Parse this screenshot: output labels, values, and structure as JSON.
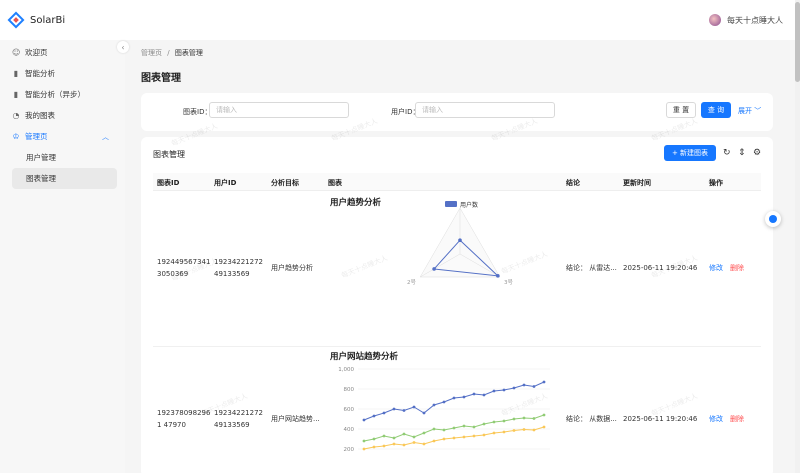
{
  "app": {
    "name": "SolarBi"
  },
  "user": {
    "name": "每天十点睡大人"
  },
  "sidebar": {
    "items": [
      {
        "label": "欢迎页",
        "icon": "smile-icon"
      },
      {
        "label": "智能分析",
        "icon": "bar-chart-icon"
      },
      {
        "label": "智能分析（异步）",
        "icon": "bar-chart-icon"
      },
      {
        "label": "我的图表",
        "icon": "pie-chart-icon"
      },
      {
        "label": "管理页",
        "icon": "crown-icon"
      },
      {
        "label": "用户管理"
      },
      {
        "label": "图表管理"
      }
    ]
  },
  "breadcrumb": {
    "root": "管理页",
    "sep": "/",
    "current": "图表管理"
  },
  "page": {
    "title": "图表管理"
  },
  "search": {
    "chart_id_label": "图表ID：",
    "chart_id_placeholder": "请输入",
    "user_id_label": "用户ID：",
    "user_id_placeholder": "请输入",
    "reset_label": "重 置",
    "query_label": "查 询",
    "expand_label": "展开"
  },
  "table": {
    "title": "图表管理",
    "new_button": "+ 新建图表",
    "columns": [
      "图表ID",
      "用户ID",
      "分析目标",
      "图表",
      "结论",
      "更新时间",
      "操作"
    ],
    "rows": [
      {
        "chart_id": "1924495673413050369",
        "user_id": "1923422127249133569",
        "goal": "用户趋势分析",
        "chart_title": "用户趋势分析",
        "conclusion": "结论： 从雷达...",
        "updated": "2025-06-11 19:20:46",
        "edit": "修改",
        "delete": "删除"
      },
      {
        "chart_id": "1923780982961 47970",
        "user_id": "1923422127249133569",
        "goal": "用户网站趋势...",
        "chart_title": "用户网站趋势分析",
        "conclusion": "结论： 从数据...",
        "updated": "2025-06-11 19:20:46",
        "edit": "修改",
        "delete": "删除"
      }
    ]
  },
  "watermark": "每天十点睡大人",
  "colors": {
    "primary": "#1677ff",
    "danger": "#ff4d4f",
    "series_blue": "#5470c6",
    "series_green": "#91cc75",
    "series_yellow": "#fac858"
  },
  "chart_data": [
    {
      "type": "radar",
      "title": "用户趋势分析",
      "legend": [
        "用户数"
      ],
      "legend_position": "top",
      "indicators": [
        "",
        "3号",
        "2号"
      ],
      "series": [
        {
          "name": "用户数",
          "values": [
            0.3,
            0.95,
            0.65
          ]
        }
      ],
      "max": 1
    },
    {
      "type": "line",
      "title": "用户网站趋势分析",
      "y_ticks": [
        "1,000",
        "800",
        "600",
        "400",
        "200"
      ],
      "ylim": [
        200,
        1000
      ],
      "grid": true,
      "series": [
        {
          "values": [
            490,
            530,
            560,
            600,
            585,
            620,
            560,
            640,
            670,
            710,
            720,
            750,
            740,
            780,
            790,
            810,
            840,
            825,
            870
          ]
        },
        {
          "values": [
            280,
            300,
            330,
            310,
            350,
            320,
            360,
            400,
            390,
            410,
            430,
            420,
            450,
            470,
            480,
            500,
            510,
            505,
            540
          ]
        },
        {
          "values": [
            200,
            220,
            230,
            250,
            240,
            265,
            250,
            280,
            300,
            310,
            320,
            330,
            340,
            360,
            370,
            385,
            395,
            390,
            420
          ]
        }
      ]
    }
  ]
}
